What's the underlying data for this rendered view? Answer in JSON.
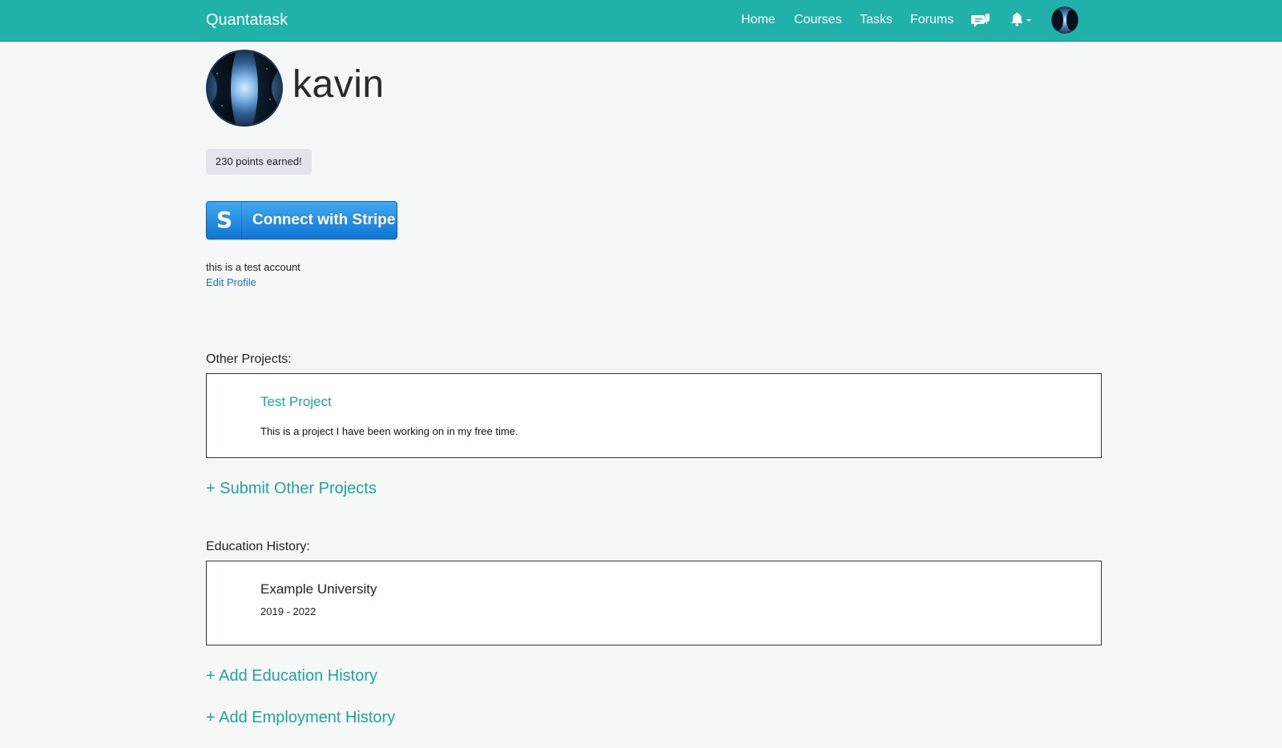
{
  "nav": {
    "brand": "Quantatask",
    "links": [
      "Home",
      "Courses",
      "Tasks",
      "Forums"
    ],
    "icons": {
      "chat": "chat-bubbles-icon",
      "notifications": "bell-icon",
      "avatar": "user-avatar"
    }
  },
  "colors": {
    "accent": "#20b2aa",
    "link_teal": "#20a59d",
    "link_blue": "#1a73b8",
    "stripe_blue": "#0f76d3"
  },
  "profile": {
    "username": "kavin",
    "points": "230 points earned!",
    "stripe_button": "Connect with Stripe",
    "bio": "this is a test account",
    "edit_link": "Edit Profile"
  },
  "other_projects": {
    "heading": "Other Projects:",
    "items": [
      {
        "title": "Test Project",
        "description": "This is a project I have been working on in my free time."
      }
    ],
    "add_label": "+ Submit Other Projects"
  },
  "education": {
    "heading": "Education History:",
    "items": [
      {
        "school": "Example University",
        "years": "2019 - 2022"
      }
    ],
    "add_label": "+ Add Education History"
  },
  "employment": {
    "add_label": "+ Add Employment History"
  }
}
